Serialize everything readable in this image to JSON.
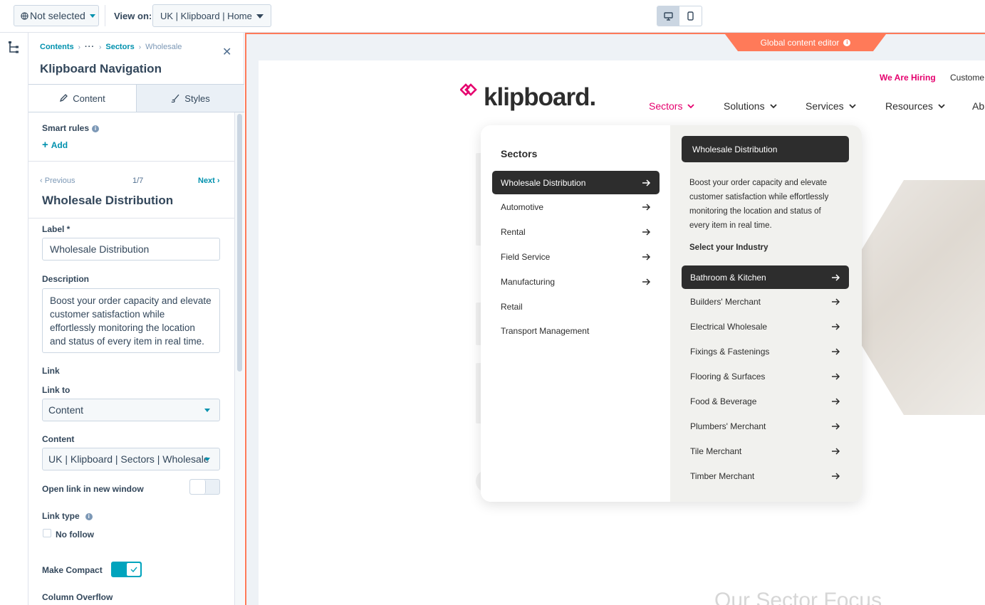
{
  "topbar": {
    "language_label": "Not selected",
    "view_on_label": "View on:",
    "view_on_value": "UK | Klipboard | Home"
  },
  "panel": {
    "breadcrumb": {
      "root": "Contents",
      "ellipsis": "···",
      "parent": "Sectors",
      "current": "Wholesale"
    },
    "title": "Klipboard Navigation",
    "tabs": {
      "content": "Content",
      "styles": "Styles"
    },
    "smart_rules_label": "Smart rules",
    "add_label": "Add",
    "pager": {
      "prev": "Previous",
      "count": "1/7",
      "next": "Next"
    },
    "item_title": "Wholesale Distribution",
    "label_field": {
      "label": "Label *",
      "value": "Wholesale Distribution"
    },
    "description_field": {
      "label": "Description",
      "value": "Boost your order capacity and elevate customer satisfaction while effortlessly monitoring the location and status of every item in real time."
    },
    "link_section_label": "Link",
    "link_to": {
      "label": "Link to",
      "value": "Content"
    },
    "content": {
      "label": "Content",
      "value": "UK | Klipboard | Sectors | Wholesale"
    },
    "open_new_window": {
      "label": "Open link in new window",
      "on": false
    },
    "link_type": {
      "label": "Link type",
      "no_follow_label": "No follow",
      "checked": false
    },
    "make_compact": {
      "label": "Make Compact",
      "on": true
    },
    "column_overflow_label": "Column Overflow"
  },
  "preview": {
    "global_editor_label": "Global content editor",
    "site": {
      "hiring": "We Are Hiring",
      "customer": "Custome",
      "logo": "klipboard.",
      "nav": [
        "Sectors",
        "Solutions",
        "Services",
        "Resources",
        "Ab"
      ],
      "focus_title": "Our Sector Focus",
      "mega": {
        "heading": "Sectors",
        "sectors": [
          {
            "label": "Wholesale Distribution",
            "arrow": true,
            "selected": true
          },
          {
            "label": "Automotive",
            "arrow": true
          },
          {
            "label": "Rental",
            "arrow": true
          },
          {
            "label": "Field Service",
            "arrow": true
          },
          {
            "label": "Manufacturing",
            "arrow": true
          },
          {
            "label": "Retail",
            "arrow": false
          },
          {
            "label": "Transport Management",
            "arrow": false
          }
        ],
        "right_heading": "Wholesale Distribution",
        "description": "Boost your order capacity and elevate customer satisfaction while effortlessly monitoring the location and status of every item in real time.",
        "industry_heading": "Select your Industry",
        "industries": [
          "Bathroom & Kitchen",
          "Builders' Merchant",
          "Electrical Wholesale",
          "Fixings & Fastenings",
          "Flooring & Surfaces",
          "Food & Beverage",
          "Plumbers' Merchant",
          "Tile Merchant",
          "Timber Merchant"
        ]
      }
    }
  },
  "colors": {
    "accent": "#0091ae",
    "brand_pink": "#e5006e",
    "editor_orange": "#ff7a59",
    "menu_dark": "#2d2d2d"
  }
}
